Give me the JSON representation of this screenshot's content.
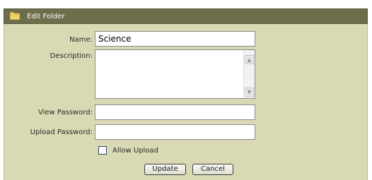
{
  "header": {
    "title": "Edit Folder",
    "icon": "folder-icon",
    "background_color": "#6e6e4c"
  },
  "form": {
    "name_label": "Name:",
    "name_value": "Science",
    "description_label": "Description:",
    "description_value": "",
    "view_password_label": "View Password:",
    "view_password_value": "",
    "upload_password_label": "Upload Password:",
    "upload_password_value": "",
    "allow_upload_label": "Allow Upload",
    "allow_upload_checked": false
  },
  "buttons": {
    "update_label": "Update",
    "cancel_label": "Cancel"
  },
  "colors": {
    "panel_background": "#d9d9b4",
    "header_background": "#6e6e4c"
  }
}
